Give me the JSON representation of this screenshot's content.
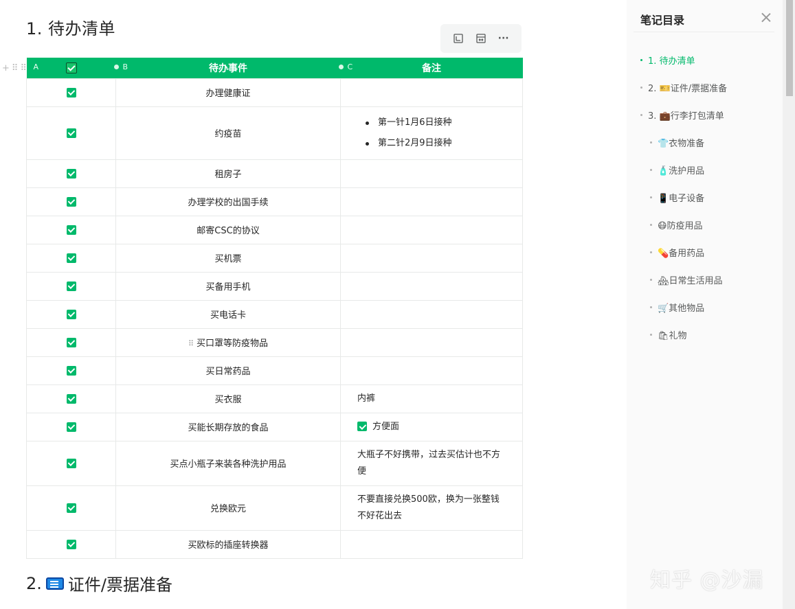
{
  "doc": {
    "heading1": "1. 待办清单",
    "heading2_prefix": "2.",
    "heading2_text": "证件/票据准备"
  },
  "table": {
    "col_a": "A",
    "col_b": "B",
    "col_c": "C",
    "header_item": "待办事件",
    "header_note": "备注",
    "rows": [
      {
        "item": "办理健康证",
        "done": true
      },
      {
        "item": "约疫苗",
        "done": true,
        "note_list": [
          "第一针1月6日接种",
          "第二针2月9日接种"
        ]
      },
      {
        "item": "租房子",
        "done": true
      },
      {
        "item": "办理学校的出国手续",
        "done": true
      },
      {
        "item": "邮寄CSC的协议",
        "done": true
      },
      {
        "item": "买机票",
        "done": true
      },
      {
        "item": "买备用手机",
        "done": true
      },
      {
        "item": "买电话卡",
        "done": true
      },
      {
        "item": "买口罩等防疫物品",
        "done": true
      },
      {
        "item": "买日常药品",
        "done": true
      },
      {
        "item": "买衣服",
        "done": true,
        "note": "内裤"
      },
      {
        "item": "买能长期存放的食品",
        "done": true,
        "note": "方便面",
        "note_checked": true
      },
      {
        "item": "买点小瓶子来装各种洗护用品",
        "done": true,
        "note": "大瓶子不好携带，过去买估计也不方便"
      },
      {
        "item": "兑换欧元",
        "done": true,
        "note": "不要直接兑换500欧，换为一张整钱不好花出去"
      },
      {
        "item": "买欧标的插座转换器",
        "done": true
      }
    ]
  },
  "toolbar": {
    "icons": [
      "image-icon",
      "fit-width-icon",
      "more-icon"
    ],
    "more_label": "···"
  },
  "sidebar": {
    "title": "笔记目录",
    "items": [
      {
        "label": "1. 待办清单",
        "active": true
      },
      {
        "label": "2. 🎫证件/票据准备"
      },
      {
        "label": "3. 💼行李打包清单"
      },
      {
        "label": "👕衣物准备"
      },
      {
        "label": "🧴洗护用品"
      },
      {
        "label": "📱电子设备"
      },
      {
        "label": "😷防疫用品"
      },
      {
        "label": "💊备用药品"
      },
      {
        "label": "🏘日常生活用品"
      },
      {
        "label": "🛒其他物品"
      },
      {
        "label": "🛍礼物"
      }
    ]
  },
  "watermark": "知乎 @沙漏",
  "colors": {
    "accent": "#00b96b",
    "header_bg": "#00b96b",
    "border": "#e7e9e8",
    "sidebar_bg": "#fafafa"
  }
}
